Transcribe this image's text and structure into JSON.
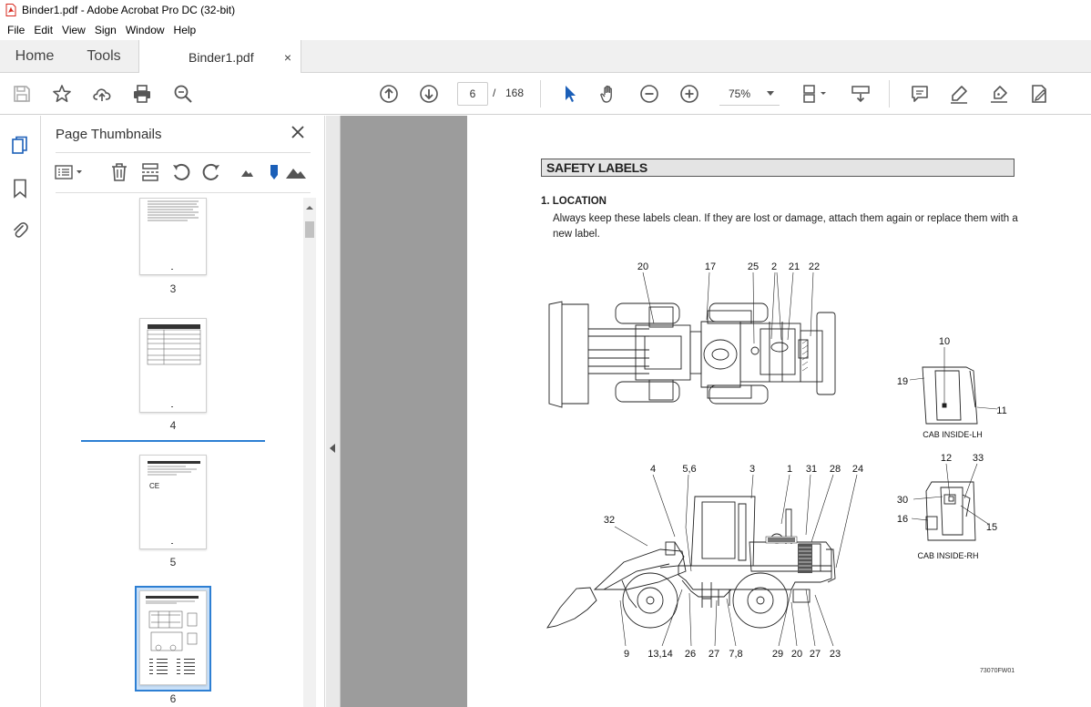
{
  "window": {
    "title": "Binder1.pdf - Adobe Acrobat Pro DC (32-bit)"
  },
  "menu": [
    "File",
    "Edit",
    "View",
    "Sign",
    "Window",
    "Help"
  ],
  "tabs": {
    "home": "Home",
    "tools": "Tools",
    "document": "Binder1.pdf",
    "close": "×"
  },
  "toolbar": {
    "current_page": "6",
    "page_separator": "/",
    "total_pages": "168",
    "zoom": "75%"
  },
  "panel": {
    "title": "Page Thumbnails",
    "thumbnails": [
      {
        "label": "3"
      },
      {
        "label": "4"
      },
      {
        "label": "5"
      },
      {
        "label": "6",
        "selected": true
      }
    ]
  },
  "document": {
    "section_title": "SAFETY LABELS",
    "subheading": "1. LOCATION",
    "body": "Always keep these labels clean.  If they are lost or damage, attach them again or replace them with a new label.",
    "figure_code": "73070FW01",
    "callouts_top": [
      "20",
      "17",
      "25",
      "2",
      "21",
      "22"
    ],
    "callouts_bottom_top": [
      "4",
      "5,6",
      "3",
      "1",
      "31",
      "28",
      "24",
      "32"
    ],
    "callouts_bottom_under": [
      "9",
      "13,14",
      "26",
      "27",
      "7,8",
      "29",
      "20",
      "27",
      "23"
    ],
    "cab_lh": {
      "caption": "CAB INSIDE-LH",
      "callouts": [
        "10",
        "19",
        "11"
      ]
    },
    "cab_rh": {
      "caption": "CAB INSIDE-RH",
      "callouts": [
        "12",
        "33",
        "30",
        "16",
        "15"
      ]
    }
  },
  "colors": {
    "accent": "#2d7fd3",
    "doc_background": "#9c9c9c",
    "pdf_icon": "#d7281e"
  }
}
